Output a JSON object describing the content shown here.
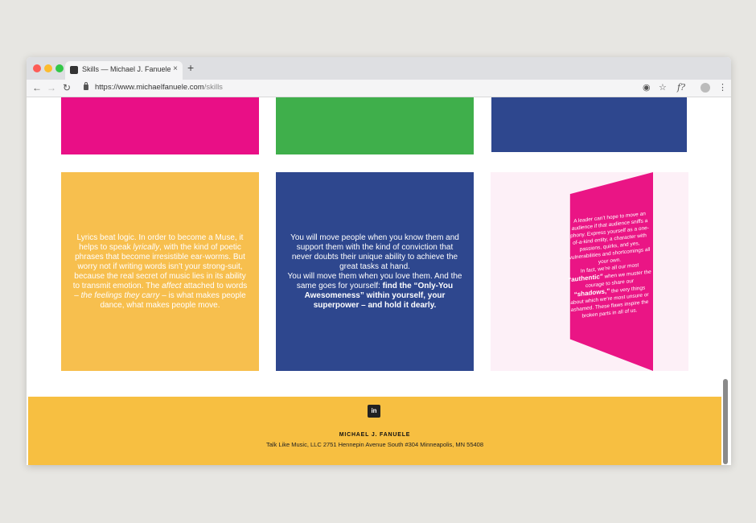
{
  "browser": {
    "tab_title": "Skills — Michael J. Fanuele",
    "tab_close": "×",
    "new_tab": "+",
    "url_host": "https://www.michaelfanuele.com",
    "url_path": "/skills",
    "back": "←",
    "forward": "→",
    "reload": "↻",
    "star": "☆",
    "ext_label": "f?",
    "menu": "⋮"
  },
  "colors": {
    "pink": "#e90f86",
    "green": "#3faf4b",
    "navy": "#2e478e",
    "yellow": "#f7bf4e",
    "footer": "#f7bf41"
  },
  "cards": {
    "yellow_pre": "Lyrics beat logic. In order to become a Muse, it helps to speak ",
    "yellow_em1": "lyrically",
    "yellow_mid": ", with the kind of poetic phrases that become irresistible ear-worms. But worry not if writing words isn’t your strong-suit, because the real secret of music lies in its ability to transmit emotion. The ",
    "yellow_em2": "affect",
    "yellow_mid2": " attached to words – ",
    "yellow_em3": "the feelings they carry",
    "yellow_post": " – is what makes people dance, what makes people move.",
    "blue_line1": "You will move people when you know them and support them with the kind of conviction that never doubts their unique ability to achieve the great tasks at hand.",
    "blue_line2": "You will move them when you love them. And the same goes for yourself: ",
    "blue_bold": "find the “Only-You Awesomeness” within yourself, your superpower – and hold it dearly.",
    "panel_pre": "A leader can’t hope to move an audience if that audience sniffs a phony. Express yourself as a one-of-a-kind entity, a character with passions, quirks, and yes, vulnerabilities and shortcomings all your own.",
    "panel_mid": "In fact, we’re all our most ",
    "panel_b1": "“authentic”",
    "panel_mid2": " when we muster the courage to share our ",
    "panel_b2": "“shadows,”",
    "panel_post": " the very things about which we’re most unsure or ashamed. These flaws inspire the broken parts in all of us."
  },
  "footer": {
    "linkedin": "in",
    "name": "MICHAEL J. FANUELE",
    "address": "Talk Like Music, LLC 2751 Hennepin Avenue South #304 Minneapolis, MN 55408"
  }
}
